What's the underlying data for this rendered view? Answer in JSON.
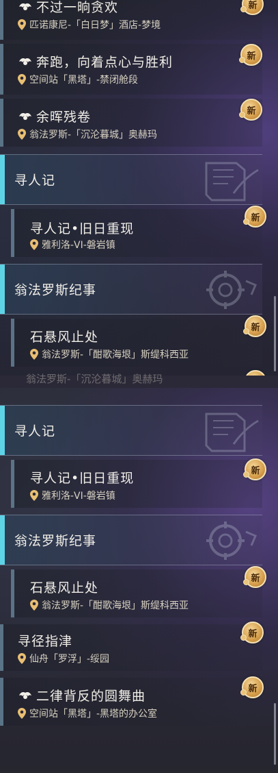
{
  "top_list": {
    "quests": [
      {
        "title": "不过一晌贪欢",
        "location": "匹诺康尼-「白日梦」酒店-梦境",
        "icon": "trailblaze-icon",
        "new": true
      },
      {
        "title": "奔跑，向着点心与胜利",
        "location": "空间站「黑塔」-禁闭舱段",
        "icon": "trailblaze-icon",
        "new": true
      },
      {
        "title": "余晖残卷",
        "location": "翁法罗斯-「沉沦暮城」奥赫玛",
        "icon": "trailblaze-icon",
        "new": true
      }
    ],
    "category_1": "寻人记",
    "sub_quest_1": {
      "title": "寻人记•旧日重现",
      "location": "雅利洛-VI-磐岩镇",
      "new": true
    },
    "category_2": "翁法罗斯纪事",
    "sub_quest_2": {
      "title": "石悬风止处",
      "location": "翁法罗斯-「酣歌海垠」斯缇科西亚",
      "new": true
    }
  },
  "seam_fragment": "翁法罗斯-「沉沦暮城」奥赫玛",
  "bottom_list": {
    "category_1": "寻人记",
    "sub_quest_1": {
      "title": "寻人记•旧日重现",
      "location": "雅利洛-VI-磐岩镇",
      "new": true
    },
    "category_2": "翁法罗斯纪事",
    "sub_quest_2": {
      "title": "石悬风止处",
      "location": "翁法罗斯-「酣歌海垠」斯缇科西亚",
      "new": true
    },
    "quests": [
      {
        "title": "寻径指津",
        "location": "仙舟「罗浮」-绥园",
        "icon": "",
        "new": true
      },
      {
        "title": "二律背反的圆舞曲",
        "location": "空间站「黑塔」-黑塔的办公室",
        "icon": "trailblaze-icon",
        "new": true
      }
    ]
  },
  "new_badge_label": "新",
  "colors": {
    "category_accent": "#5fd3e6",
    "quest_bar": "#5a7386",
    "badge": "#d59d4a",
    "pin": "#e8bf73"
  }
}
